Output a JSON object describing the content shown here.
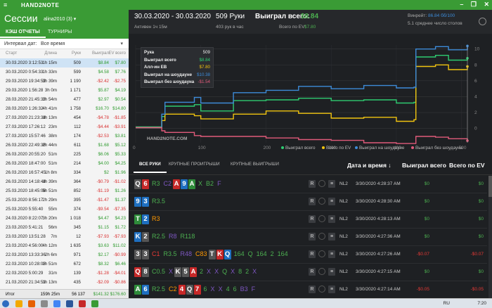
{
  "app": {
    "title": "HAND2NOTE",
    "menu": "≡",
    "window_controls": "– ❐ ✕"
  },
  "left": {
    "title": "Сессии",
    "user": "alina2010 (3) ▾",
    "tabs": [
      "КЭШ ОТЧЕТЫ",
      "ТУРНИРЫ"
    ],
    "interval_label": "Интервал дат:",
    "interval_value": "Все время",
    "interval_caret": "▾",
    "columns": [
      "Старт",
      "Длина",
      "Руки",
      "Выиграл",
      "EV всего"
    ],
    "rows": [
      [
        "30.03.2020 3:12:53",
        "1h 15m",
        "509",
        "$8.84",
        "$7.80",
        "g",
        "g"
      ],
      [
        "30.03.2020 0:54:33",
        "1h 33m",
        "599",
        "$4.58",
        "$7.76",
        "g",
        "g"
      ],
      [
        "29.03.2020 19:34:52",
        "3h 39m",
        "1 190",
        "-$2.42",
        "-$2.75",
        "r",
        "r"
      ],
      [
        "29.03.2020 1:56:28",
        "3h 0m",
        "1 171",
        "$5.87",
        "$4.19",
        "g",
        "g"
      ],
      [
        "28.03.2020 21:45:33",
        "1h 54m",
        "477",
        "$2.97",
        "$0.54",
        "g",
        "g"
      ],
      [
        "28.03.2020 1:26:32",
        "4h 41m",
        "1 758",
        "$16.70",
        "$14.80",
        "g",
        "g"
      ],
      [
        "27.03.2020 21:23:34",
        "1h 13m",
        "454",
        "-$4.78",
        "-$1.85",
        "r",
        "r"
      ],
      [
        "27.03.2020 17:26:12",
        "23m",
        "112",
        "-$4.44",
        "-$3.91",
        "r",
        "r"
      ],
      [
        "27.03.2020 15:57:46",
        "38m",
        "174",
        "-$2.53",
        "$3.81",
        "r",
        "g"
      ],
      [
        "26.03.2020 22:49:36",
        "2h 44m",
        "611",
        "$1.68",
        "$5.12",
        "g",
        "g"
      ],
      [
        "26.03.2020 20:55:20",
        "51m",
        "225",
        "$6.06",
        "$5.33",
        "g",
        "g"
      ],
      [
        "26.03.2020 18:47:00",
        "51m",
        "214",
        "$4.00",
        "$4.25",
        "g",
        "g"
      ],
      [
        "26.03.2020 16:57:45",
        "1h 8m",
        "334",
        "$2",
        "$1.96",
        "g",
        "g"
      ],
      [
        "26.03.2020 14:18:44",
        "1h 39m",
        "364",
        "-$0.79",
        "-$1.02",
        "r",
        "r"
      ],
      [
        "25.03.2020 18:45:06",
        "5h 51m",
        "852",
        "-$1.19",
        "$1.26",
        "r",
        "g"
      ],
      [
        "25.03.2020 8:56:17",
        "2h 29m",
        "395",
        "-$1.47",
        "$1.37",
        "r",
        "g"
      ],
      [
        "25.03.2020 5:55:40",
        "55m",
        "374",
        "-$9.54",
        "-$7.35",
        "r",
        "r"
      ],
      [
        "24.03.2020 8:22:07",
        "3h 20m",
        "1 018",
        "$4.47",
        "$4.23",
        "g",
        "g"
      ],
      [
        "23.03.2020 5:41:21",
        "56m",
        "345",
        "$1.15",
        "$1.72",
        "g",
        "g"
      ],
      [
        "23.03.2020 13:51:28",
        "7m",
        "12",
        "-$7.93",
        "-$7.93",
        "r",
        "r"
      ],
      [
        "23.03.2020 4:56:00",
        "4h 12m",
        "1 635",
        "$3.63",
        "$11.02",
        "g",
        "g"
      ],
      [
        "22.03.2020 13:33:36",
        "2h 6m",
        "971",
        "$2.17",
        "-$0.99",
        "g",
        "r"
      ],
      [
        "22.03.2020 10:28:08",
        "1h 51m",
        "672",
        "$8.32",
        "$6.46",
        "g",
        "g"
      ],
      [
        "22.03.2020 5:00:29",
        "31m",
        "139",
        "-$1.28",
        "-$4.01",
        "r",
        "r"
      ],
      [
        "21.03.2020 21:34:51",
        "1h 13m",
        "435",
        "-$2.09",
        "-$0.86",
        "r",
        "r"
      ]
    ],
    "total": {
      "label": "Итог",
      "length": "159h 25m",
      "hands": "56 137",
      "won": "$141.32",
      "ev": "$176.60"
    }
  },
  "summary": {
    "dates": "30.03.2020 - 30.03.2020",
    "active": "Активен 1ч 15м",
    "hands": "509 Руки",
    "hph": "403 рук в час",
    "won_label": "Выиграл всего:",
    "won": "$8.84",
    "ev_label": "Всего по EV:",
    "ev": "$7.80",
    "winrate_label": "Винрейт:",
    "winrate": "86.84 бб/100",
    "tables": "5.1 среднее число столов",
    "gear": "gear"
  },
  "chart_data": {
    "type": "line",
    "xlim": [
      0,
      509
    ],
    "ylim": [
      -1.8,
      10.5
    ],
    "x_ticks": [
      "0",
      "100",
      "200",
      "300",
      "400",
      "500"
    ],
    "y_ticks": [
      "10",
      "8",
      "6",
      "4",
      "2",
      "0"
    ],
    "watermark": "HAND2NOTE.COM",
    "series": [
      {
        "name": "Выиграл всего",
        "color": "#2ecc71",
        "x": [
          0,
          40,
          45,
          90,
          100,
          150,
          200,
          250,
          300,
          350,
          400,
          427,
          430,
          460,
          480,
          509
        ],
        "values": [
          0.2,
          1.5,
          2.8,
          3.0,
          2.2,
          3.5,
          3.6,
          3.8,
          3.5,
          3.6,
          3.2,
          3.3,
          9.0,
          9.2,
          8.6,
          8.84
        ]
      },
      {
        "name": "Всего по EV",
        "color": "#f1c40f",
        "x": [
          0,
          40,
          45,
          90,
          100,
          150,
          200,
          250,
          300,
          350,
          400,
          427,
          430,
          460,
          480,
          509
        ],
        "values": [
          0.1,
          1.0,
          1.8,
          1.6,
          1.2,
          1.8,
          2.2,
          1.9,
          1.3,
          1.4,
          0.9,
          1.1,
          7.8,
          8.0,
          7.4,
          7.8
        ]
      },
      {
        "name": "Выиграл на шоудауне",
        "color": "#3d8bd9",
        "x": [
          0,
          40,
          45,
          90,
          100,
          150,
          200,
          250,
          300,
          350,
          400,
          427,
          430,
          460,
          480,
          509
        ],
        "values": [
          0.1,
          1.8,
          3.3,
          3.9,
          3.2,
          4.5,
          4.8,
          5.3,
          5.0,
          5.4,
          5.1,
          5.2,
          10.0,
          10.3,
          9.9,
          10.38
        ]
      },
      {
        "name": "Выиграл без шоудауна",
        "color": "#e05a7a",
        "x": [
          0,
          40,
          45,
          90,
          100,
          150,
          200,
          250,
          300,
          350,
          400,
          427,
          430,
          460,
          480,
          509
        ],
        "values": [
          0.1,
          -0.3,
          -0.5,
          -0.9,
          -1.0,
          -1.0,
          -1.2,
          -1.4,
          -1.5,
          -1.8,
          -1.9,
          -1.9,
          -1.0,
          -1.1,
          -1.3,
          -1.54
        ]
      }
    ],
    "tooltip": {
      "rows": [
        [
          "Рука",
          "509"
        ],
        [
          "Выиграл всего",
          "$8.84"
        ],
        [
          "Алл-ин EВ",
          "$7.80"
        ],
        [
          "Выиграл на шоудауне",
          "$10.38"
        ],
        [
          "Выиграл без шоудауна",
          "-$1.54"
        ]
      ]
    }
  },
  "hands_tabs": [
    "ВСЕ РУКИ",
    "КРУПНЫЕ ПРОИГРЫШИ",
    "КРУПНЫЕ ВЫИГРЫШИ"
  ],
  "hands_headers": {
    "date": "Дата и время ↓",
    "won": "Выиграл всего",
    "ev": "Всего по EV"
  },
  "hands": [
    {
      "cards": [
        [
          "Q",
          "s"
        ],
        [
          "6",
          "h"
        ]
      ],
      "actions": [
        [
          "R3",
          "ap"
        ],
        [
          "C2",
          "ab"
        ]
      ],
      "board": [
        [
          "A",
          "h"
        ],
        [
          "9",
          "d"
        ],
        [
          "A",
          "c"
        ]
      ],
      "post": [
        [
          "X",
          "ag"
        ],
        [
          "B2",
          "ag"
        ],
        [
          "F",
          "ab"
        ]
      ],
      "limit": "NL2",
      "time": "3/30/2020 4:28:37 AM",
      "won": "$0",
      "ev": "$0",
      "wc": "g",
      "ec": "g"
    },
    {
      "cards": [
        [
          "9",
          "d"
        ],
        [
          "3",
          "d"
        ]
      ],
      "actions": [
        [
          "R3.5",
          "ap"
        ]
      ],
      "board": [],
      "post": [],
      "limit": "NL2",
      "time": "3/30/2020 4:28:30 AM",
      "won": "$0",
      "ev": "$0",
      "wc": "g",
      "ec": "g"
    },
    {
      "cards": [
        [
          "T",
          "c"
        ],
        [
          "2",
          "d"
        ]
      ],
      "actions": [
        [
          "R3",
          "ao"
        ]
      ],
      "board": [],
      "post": [],
      "limit": "NL2",
      "time": "3/30/2020 4:28:13 AM",
      "won": "$0",
      "ev": "$0",
      "wc": "g",
      "ec": "g"
    },
    {
      "cards": [
        [
          "K",
          "d"
        ],
        [
          "2",
          "s"
        ]
      ],
      "actions": [
        [
          "R2.5",
          "ap"
        ],
        [
          "R8",
          "ab"
        ],
        [
          "R118",
          "ap"
        ]
      ],
      "board": [],
      "post": [],
      "limit": "NL2",
      "time": "3/30/2020 4:27:36 AM",
      "won": "$0",
      "ev": "$0",
      "wc": "g",
      "ec": "g"
    },
    {
      "cards": [
        [
          "3",
          "s"
        ],
        [
          "3",
          "s"
        ]
      ],
      "actions": [
        [
          "C1",
          "ar"
        ],
        [
          "R3.5",
          "ap"
        ],
        [
          "R48",
          "ab"
        ],
        [
          "C83",
          "ao"
        ]
      ],
      "board": [
        [
          "T",
          "s"
        ],
        [
          "K",
          "h"
        ],
        [
          "Q",
          "d"
        ]
      ],
      "post": [
        [
          "164",
          "ag"
        ],
        [
          "Q",
          "ag"
        ],
        [
          "164",
          "ag"
        ],
        [
          "2",
          "ag"
        ],
        [
          "164",
          "ag"
        ]
      ],
      "limit": "NL2",
      "time": "3/30/2020 4:27:26 AM",
      "won": "-$0.07",
      "ev": "-$0.07",
      "wc": "r",
      "ec": "r"
    },
    {
      "cards": [
        [
          "Q",
          "h"
        ],
        [
          "8",
          "s"
        ]
      ],
      "actions": [
        [
          "C0.5",
          "ap"
        ],
        [
          "X",
          "ab"
        ]
      ],
      "board": [
        [
          "K",
          "s"
        ],
        [
          "5",
          "s"
        ],
        [
          "A",
          "h"
        ]
      ],
      "post": [
        [
          "2",
          "ag"
        ],
        [
          "X",
          "ab"
        ],
        [
          "X",
          "ab"
        ],
        [
          "Q",
          "ag"
        ],
        [
          "X",
          "ab"
        ],
        [
          "8",
          "ag"
        ],
        [
          "2",
          "ag"
        ],
        [
          "X",
          "ab"
        ]
      ],
      "limit": "NL2",
      "time": "3/30/2020 4:27:15 AM",
      "won": "$0",
      "ev": "$0",
      "wc": "g",
      "ec": "g"
    },
    {
      "cards": [
        [
          "A",
          "c"
        ],
        [
          "6",
          "d"
        ]
      ],
      "actions": [
        [
          "R2.5",
          "ap"
        ],
        [
          "C2",
          "ao"
        ]
      ],
      "board": [
        [
          "4",
          "h"
        ],
        [
          "Q",
          "s"
        ],
        [
          "7",
          "h"
        ]
      ],
      "post": [
        [
          "6",
          "ag"
        ],
        [
          "X",
          "ab"
        ],
        [
          "X",
          "ab"
        ],
        [
          "4",
          "ag"
        ],
        [
          "6",
          "ag"
        ],
        [
          "B3",
          "ab"
        ],
        [
          "F",
          "ab"
        ]
      ],
      "limit": "NL2",
      "time": "3/30/2020 4:27:14 AM",
      "won": "-$0.05",
      "ev": "-$0.05",
      "wc": "r",
      "ec": "r"
    }
  ],
  "taskbar": {
    "lang": "RU",
    "clock": "7:20"
  }
}
